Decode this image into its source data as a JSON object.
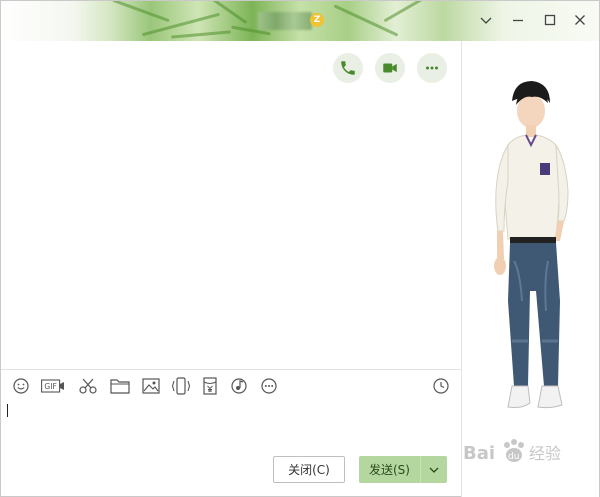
{
  "window": {
    "title_badge": "Z",
    "controls": [
      "chevron-down-icon",
      "minimize-icon",
      "maximize-icon",
      "close-icon"
    ]
  },
  "header_actions": [
    {
      "name": "voice-call-button",
      "icon": "phone-icon"
    },
    {
      "name": "video-call-button",
      "icon": "video-camera-icon"
    },
    {
      "name": "more-options-button",
      "icon": "more-dots-icon"
    }
  ],
  "toolbar": {
    "gif_label": "GIF",
    "icons": [
      "emoji-icon",
      "gif-icon",
      "scissors-icon",
      "folder-icon",
      "image-icon",
      "shake-icon",
      "red-packet-icon",
      "music-icon",
      "more-icon",
      "history-clock-icon"
    ]
  },
  "buttons": {
    "close_label": "关闭(C)",
    "send_label": "发送(S)"
  },
  "colors": {
    "accent_green": "#4a8a2c",
    "send_bg": "#b4d7a0",
    "call_btn_bg": "#e9efe4"
  },
  "watermark": {
    "text_latin": "Bai",
    "text_du": "du",
    "text_cn": "经验"
  }
}
